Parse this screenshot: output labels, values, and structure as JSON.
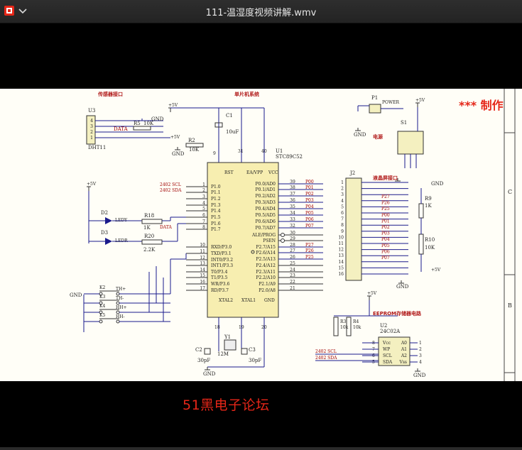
{
  "window": {
    "title": "111-温湿度视频讲解.wmv"
  },
  "colors": {
    "brand_logo": "#e52618",
    "wire": "#1a1a8c",
    "red_label": "#b01818",
    "net_label": "#a00000",
    "title_red": "#e52618"
  },
  "video": {
    "made_by": "*** 制作",
    "watermark": "51黑电子论坛",
    "schematic": {
      "section_sensor": "传感器接口",
      "section_mcu": "单片机系统",
      "section_power": "电源",
      "section_lcd": "液晶屏接口",
      "section_eeprom": "EEPROM存储器电路",
      "border_labels": [
        "C",
        "B"
      ],
      "u3": {
        "ref": "U3",
        "part": "DHT11",
        "pins": [
          "4",
          "3",
          "2",
          "1"
        ]
      },
      "u1": {
        "ref": "U1",
        "part": "STC89C52"
      },
      "u2": {
        "ref": "U2",
        "part": "24C02A"
      },
      "p1": {
        "ref": "P1",
        "label": "POWER"
      },
      "s1": {
        "ref": "S1"
      },
      "j2": {
        "ref": "J2",
        "pins": [
          "1",
          "2",
          "3",
          "4",
          "5",
          "6",
          "7",
          "8",
          "9",
          "10",
          "11",
          "12",
          "13",
          "14",
          "15",
          "16"
        ]
      },
      "power": {
        "vcc": "+5V",
        "gnd": "GND"
      },
      "sensor": {
        "r5": "R5",
        "r5_val": "10K",
        "data": "DATA",
        "r2": "R2",
        "r2_val": "10K"
      },
      "mcu_top": {
        "c1": "C1",
        "c1_val": "10uF",
        "pin_rst": "9",
        "pin_ea": "31",
        "pin_vcc": "40",
        "rst": "RST",
        "ea": "EA/VPP",
        "vcc": "VCC"
      },
      "left_pins": [
        {
          "num": "1",
          "name": "P1.0",
          "net": "2402_SCL"
        },
        {
          "num": "2",
          "name": "P1.1",
          "net": "2402_SDA"
        },
        {
          "num": "3",
          "name": "P1.2",
          "net": ""
        },
        {
          "num": "4",
          "name": "P1.3",
          "net": ""
        },
        {
          "num": "5",
          "name": "P1.4",
          "net": ""
        },
        {
          "num": "6",
          "name": "P1.5",
          "net": ""
        },
        {
          "num": "7",
          "name": "P1.6",
          "net": ""
        },
        {
          "num": "8",
          "name": "P1.7",
          "net": "DATA"
        },
        {
          "num": "10",
          "name": "RXD/P3.0",
          "net": ""
        },
        {
          "num": "11",
          "name": "TXD/P3.1",
          "net": ""
        },
        {
          "num": "12",
          "name": "INT0/P3.2",
          "net": ""
        },
        {
          "num": "13",
          "name": "INT1/P3.3",
          "net": ""
        },
        {
          "num": "14",
          "name": "T0/P3.4",
          "net": ""
        },
        {
          "num": "15",
          "name": "T1/P3.5",
          "net": ""
        },
        {
          "num": "16",
          "name": "WR/P3.6",
          "net": ""
        },
        {
          "num": "17",
          "name": "RD/P3.7",
          "net": ""
        }
      ],
      "right_pins": [
        {
          "num": "39",
          "name": "P0.0/AD0",
          "net": "P00"
        },
        {
          "num": "38",
          "name": "P0.1/AD1",
          "net": "P01"
        },
        {
          "num": "37",
          "name": "P0.2/AD2",
          "net": "P02"
        },
        {
          "num": "36",
          "name": "P0.3/AD3",
          "net": "P03"
        },
        {
          "num": "35",
          "name": "P0.4/AD4",
          "net": "P04"
        },
        {
          "num": "34",
          "name": "P0.5/AD5",
          "net": "P05"
        },
        {
          "num": "33",
          "name": "P0.6/AD6",
          "net": "P06"
        },
        {
          "num": "32",
          "name": "P0.7/AD7",
          "net": "P07"
        },
        {
          "num": "30",
          "name": "ALE/PROG",
          "net": ""
        },
        {
          "num": "29",
          "name": "PSEN",
          "net": ""
        },
        {
          "num": "28",
          "name": "P2.7/A15",
          "net": "P27"
        },
        {
          "num": "27",
          "name": "P2.6/A14",
          "net": "P26"
        },
        {
          "num": "26",
          "name": "P2.5/A13",
          "net": "P25"
        },
        {
          "num": "25",
          "name": "P2.4/A12",
          "net": ""
        },
        {
          "num": "24",
          "name": "P2.3/A11",
          "net": ""
        },
        {
          "num": "23",
          "name": "P2.2/A10",
          "net": ""
        },
        {
          "num": "22",
          "name": "P2.1/A9",
          "net": ""
        },
        {
          "num": "21",
          "name": "P2.0/A8",
          "net": ""
        }
      ],
      "mcu_bottom": {
        "xtal2": "XTAL2",
        "xtal1": "XTAL1",
        "gnd": "GND",
        "pin18": "18",
        "pin19": "19",
        "pin20": "20"
      },
      "leds": {
        "d2": "D2",
        "ledy": "LEDY",
        "d3": "D3",
        "ledr": "LEDR",
        "r18": "R18",
        "r18_val": "1K",
        "r20": "R20",
        "r20_val": "2.2K"
      },
      "keys": [
        {
          "ref": "K2",
          "net": "TH+"
        },
        {
          "ref": "K3",
          "net": "TH-"
        },
        {
          "ref": "K4",
          "net": "HH+"
        },
        {
          "ref": "K5",
          "net": "HH-"
        }
      ],
      "crystal": {
        "y1": "Y1",
        "y1_val": "12M",
        "c2": "C2",
        "c2_val": "30pF",
        "c3": "C3",
        "c3_val": "30pF"
      },
      "lcd_nets": [
        "P27",
        "P26",
        "P25",
        "P00",
        "P01",
        "P02",
        "P03",
        "P04",
        "P05",
        "P06",
        "P07"
      ],
      "lcd_res": {
        "r9": "R9",
        "r9_val": "1K",
        "r10": "R10",
        "r10_val": "10K"
      },
      "eeprom": {
        "r3": "R3",
        "r3_val": "10k",
        "r4": "R4",
        "r4_val": "10k",
        "scl": "2402_SCL",
        "sda": "2402_SDA",
        "left": [
          "Vcc",
          "WP",
          "SCL",
          "SDA"
        ],
        "right": [
          "A0",
          "A1",
          "A2",
          "Vss"
        ],
        "lpins": [
          "8",
          "7",
          "6",
          "5"
        ],
        "rpins": [
          "1",
          "2",
          "3",
          "4"
        ]
      }
    }
  }
}
